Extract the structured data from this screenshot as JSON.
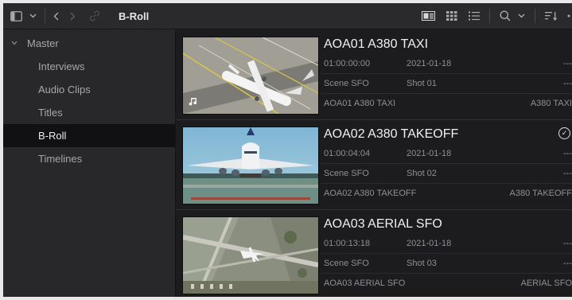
{
  "toolbar": {
    "title": "B-Roll",
    "icons": [
      "sidebar-toggle-icon",
      "chevron-down-icon",
      "back-arrow-icon",
      "forward-arrow-icon",
      "link-icon",
      "thumbnail-view-icon",
      "grid-view-icon",
      "list-view-icon",
      "search-icon",
      "chevron-down-icon",
      "sort-icon",
      "more-icon"
    ]
  },
  "sidebar": {
    "root": "Master",
    "items": [
      {
        "label": "Interviews"
      },
      {
        "label": "Audio Clips"
      },
      {
        "label": "Titles"
      },
      {
        "label": "B-Roll",
        "selected": true
      },
      {
        "label": "Timelines"
      }
    ]
  },
  "clips": [
    {
      "title": "AOA01 A380 TAXI",
      "timecode": "01:00:00:00",
      "date": "2021-01-18",
      "scene": "Scene SFO",
      "shot": "Shot 01",
      "extra1": "---",
      "extra2": "---",
      "name": "AOA01 A380 TAXI",
      "desc": "A380 TAXI",
      "has_audio": true,
      "checked": false
    },
    {
      "title": "AOA02 A380 TAKEOFF",
      "timecode": "01:00:04:04",
      "date": "2021-01-18",
      "scene": "Scene SFO",
      "shot": "Shot 02",
      "extra1": "---",
      "extra2": "---",
      "name": "AOA02 A380 TAKEOFF",
      "desc": "A380 TAKEOFF",
      "has_audio": false,
      "checked": true
    },
    {
      "title": "AOA03 AERIAL SFO",
      "timecode": "01:00:13:18",
      "date": "2021-01-18",
      "scene": "Scene SFO",
      "shot": "Shot 03",
      "extra1": "---",
      "extra2": "---",
      "name": "AOA03 AERIAL SFO",
      "desc": "AERIAL SFO",
      "has_audio": false,
      "checked": false
    }
  ],
  "colors": {
    "panel_bg": "#1d1d20",
    "sidebar_bg": "#28282b",
    "selected_bg": "#111113",
    "title_text": "#f0f0f0",
    "meta_text": "#8f8f94"
  }
}
